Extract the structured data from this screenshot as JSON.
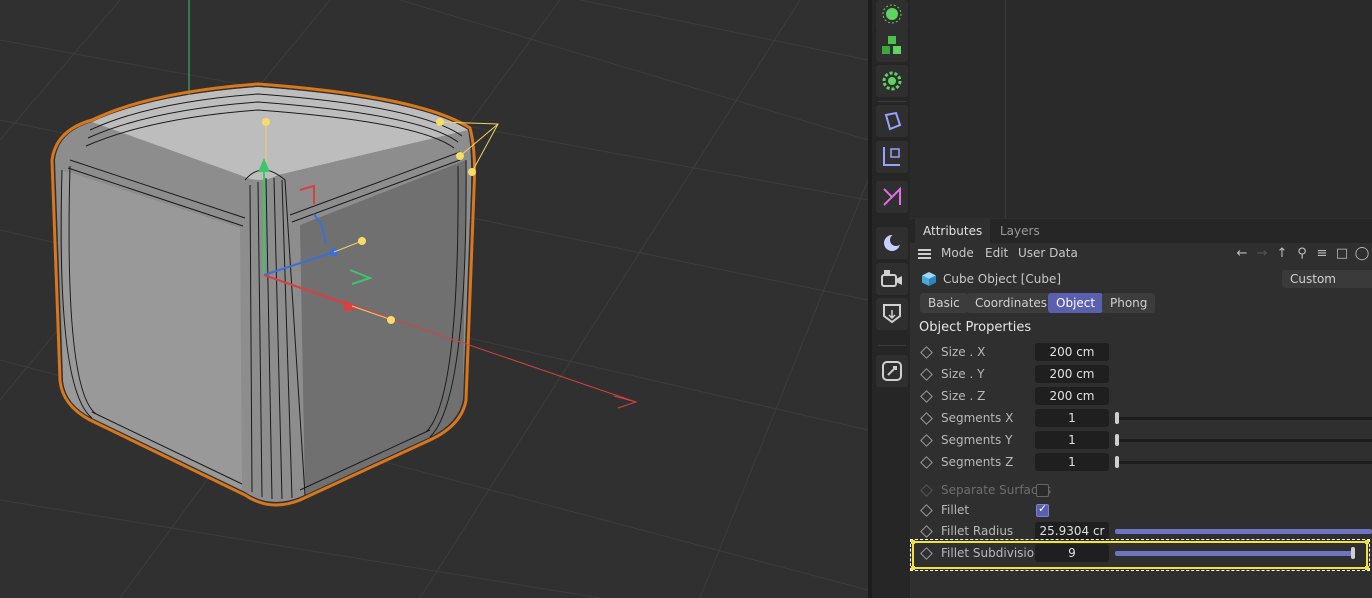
{
  "toolbar": {
    "buttons": [
      "point-light-icon",
      "cubes-icon",
      "gear-sphere-icon",
      "deformer-icon",
      "coordinates-icon",
      "spline-icon",
      "environment-icon",
      "camera-icon",
      "render-icon",
      "tag-icon"
    ]
  },
  "attributes": {
    "tabs": [
      "Attributes",
      "Layers"
    ],
    "menu": [
      "Mode",
      "Edit",
      "User Data"
    ],
    "object_title": "Cube Object [Cube]",
    "preset_dropdown": "Custom",
    "page_tabs": [
      "Basic",
      "Coordinates",
      "Object",
      "Phong"
    ],
    "active_page_tab": "Object",
    "section_title": "Object Properties",
    "size_x": {
      "label": "Size . X",
      "value": "200 cm"
    },
    "size_y": {
      "label": "Size . Y",
      "value": "200 cm"
    },
    "size_z": {
      "label": "Size . Z",
      "value": "200 cm"
    },
    "seg_x": {
      "label": "Segments X",
      "value": "1"
    },
    "seg_y": {
      "label": "Segments Y",
      "value": "1"
    },
    "seg_z": {
      "label": "Segments Z",
      "value": "1"
    },
    "separate_surfaces": {
      "label": "Separate Surfaces",
      "checked": false
    },
    "fillet": {
      "label": "Fillet",
      "checked": true
    },
    "fillet_radius": {
      "label": "Fillet Radius",
      "value": "25.9304 cr"
    },
    "fillet_subdivision": {
      "label": "Fillet Subdivision",
      "value": "9"
    }
  },
  "colors": {
    "accent": "#5a5fb0",
    "selection_outline": "#d9771c",
    "highlight": "#f2e33b",
    "axis_x": "#d94040",
    "axis_y": "#3ec46d",
    "axis_z": "#3a6ed8"
  }
}
